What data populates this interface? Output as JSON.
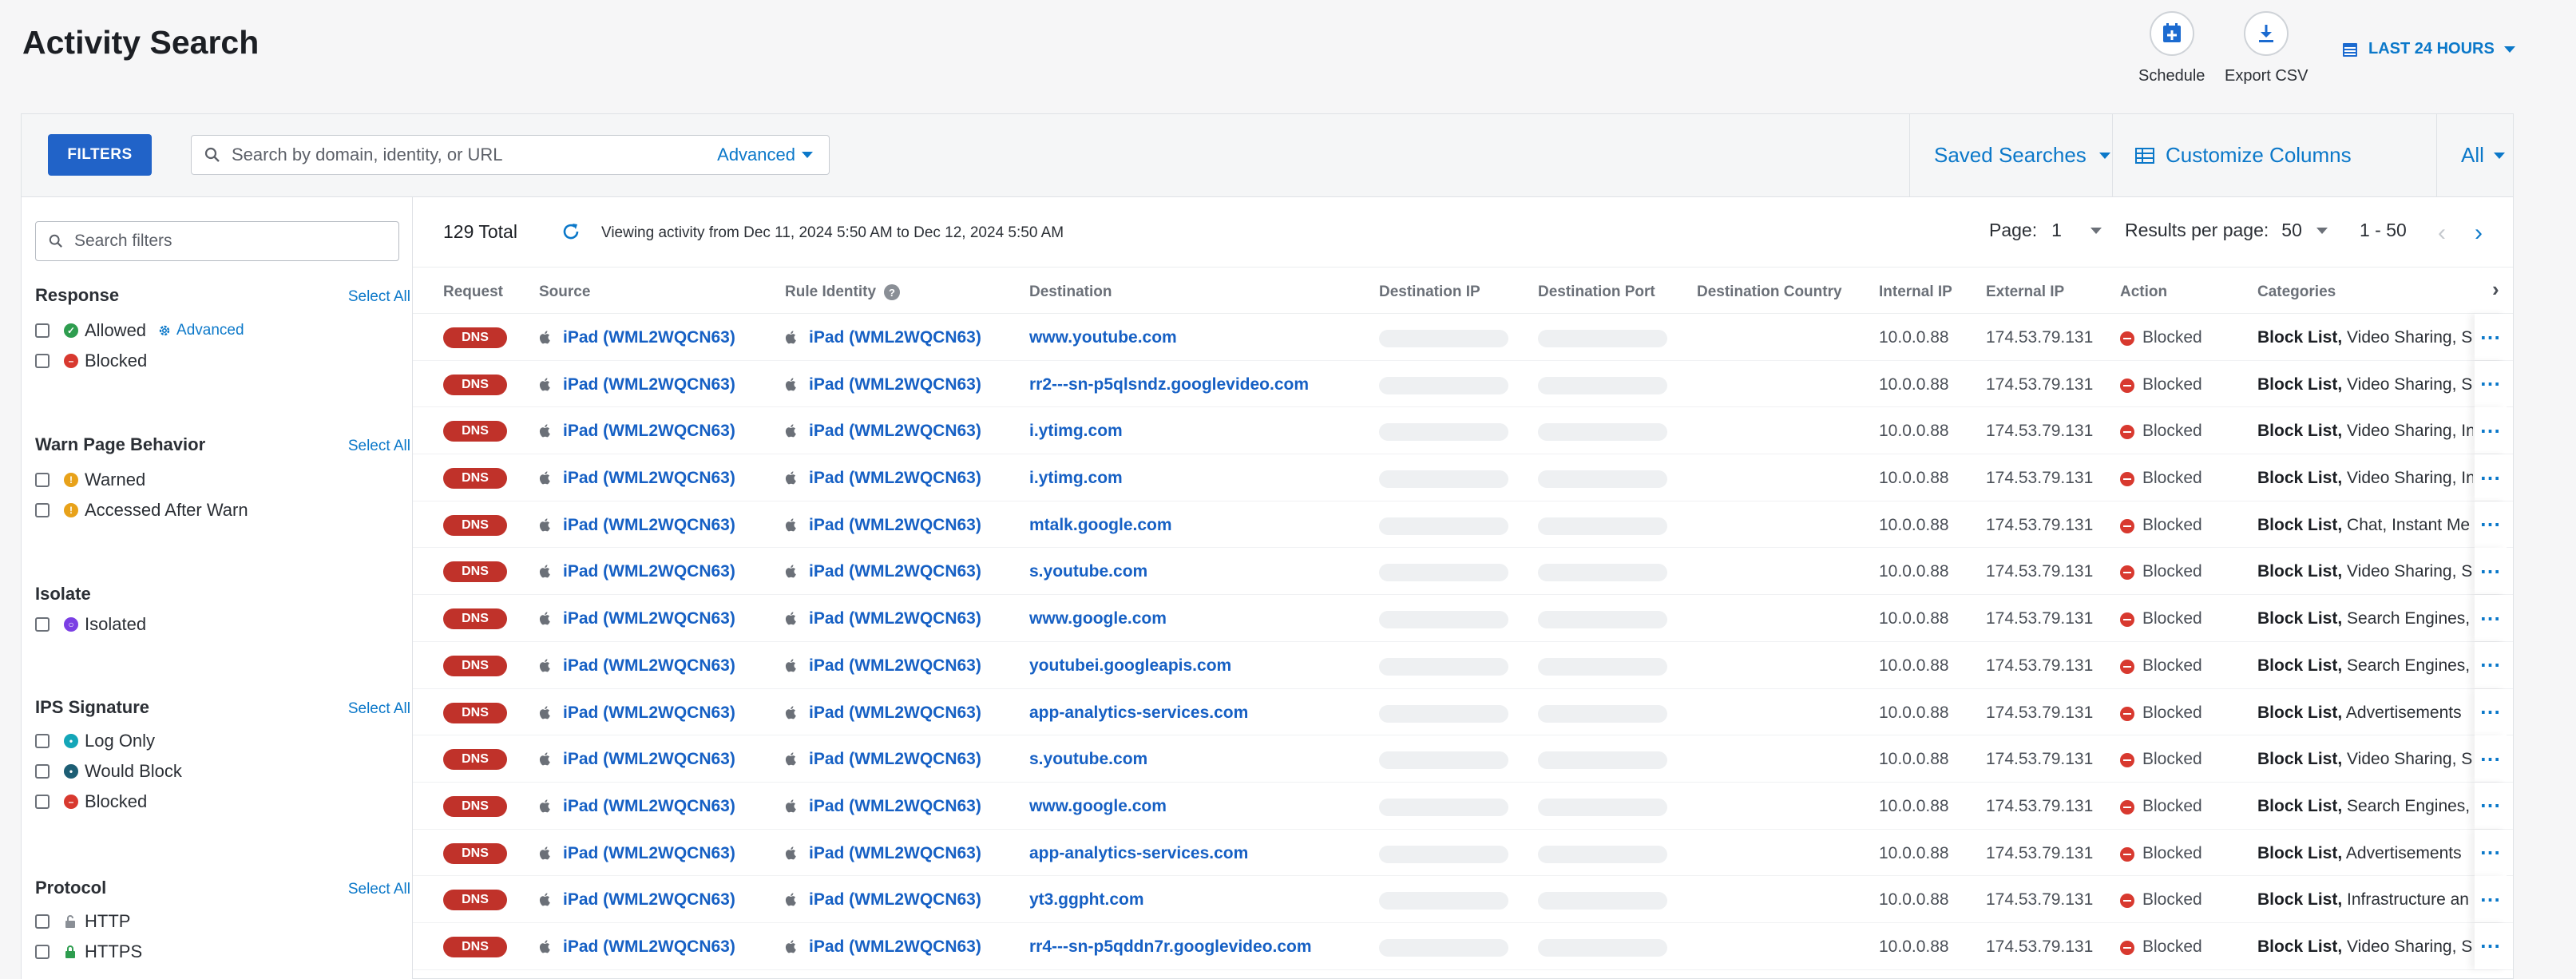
{
  "page_title": "Activity Search",
  "header_actions": {
    "schedule_label": "Schedule",
    "export_label": "Export CSV",
    "time_range": "LAST 24 HOURS"
  },
  "toolbar": {
    "filters_label": "FILTERS",
    "search_placeholder": "Search by domain, identity, or URL",
    "advanced_label": "Advanced",
    "saved_searches_label": "Saved Searches",
    "customize_columns_label": "Customize Columns",
    "scope_label": "All"
  },
  "sidebar": {
    "search_placeholder": "Search filters",
    "select_all": "Select All",
    "advanced_label": "Advanced",
    "sections": {
      "response": {
        "title": "Response",
        "options": [
          "Allowed",
          "Blocked"
        ]
      },
      "warn": {
        "title": "Warn Page Behavior",
        "options": [
          "Warned",
          "Accessed After Warn"
        ]
      },
      "isolate": {
        "title": "Isolate",
        "options": [
          "Isolated"
        ]
      },
      "ips": {
        "title": "IPS Signature",
        "options": [
          "Log Only",
          "Would Block",
          "Blocked"
        ]
      },
      "protocol": {
        "title": "Protocol",
        "options": [
          "HTTP",
          "HTTPS"
        ]
      }
    }
  },
  "summary": {
    "total": "129 Total",
    "viewing": "Viewing activity from Dec 11, 2024 5:50 AM to Dec 12, 2024 5:50 AM",
    "page_label": "Page:",
    "page_value": "1",
    "rpp_label": "Results per page:",
    "rpp_value": "50",
    "range": "1 - 50"
  },
  "columns": {
    "request": "Request",
    "source": "Source",
    "rule_identity": "Rule Identity",
    "destination": "Destination",
    "destination_ip": "Destination IP",
    "destination_port": "Destination Port",
    "destination_country": "Destination Country",
    "internal_ip": "Internal IP",
    "external_ip": "External IP",
    "action": "Action",
    "categories": "Categories"
  },
  "rows": [
    {
      "request": "DNS",
      "source": "iPad (WML2WQCN63)",
      "identity": "iPad (WML2WQCN63)",
      "destination": "www.youtube.com",
      "internal_ip": "10.0.0.88",
      "external_ip": "174.53.79.131",
      "action": "Blocked",
      "cat_bold": "Block List,",
      "cat_rest": " Video Sharing, S"
    },
    {
      "request": "DNS",
      "source": "iPad (WML2WQCN63)",
      "identity": "iPad (WML2WQCN63)",
      "destination": "rr2---sn-p5qlsndz.googlevideo.com",
      "internal_ip": "10.0.0.88",
      "external_ip": "174.53.79.131",
      "action": "Blocked",
      "cat_bold": "Block List,",
      "cat_rest": " Video Sharing, S"
    },
    {
      "request": "DNS",
      "source": "iPad (WML2WQCN63)",
      "identity": "iPad (WML2WQCN63)",
      "destination": "i.ytimg.com",
      "internal_ip": "10.0.0.88",
      "external_ip": "174.53.79.131",
      "action": "Blocked",
      "cat_bold": "Block List,",
      "cat_rest": " Video Sharing, In"
    },
    {
      "request": "DNS",
      "source": "iPad (WML2WQCN63)",
      "identity": "iPad (WML2WQCN63)",
      "destination": "i.ytimg.com",
      "internal_ip": "10.0.0.88",
      "external_ip": "174.53.79.131",
      "action": "Blocked",
      "cat_bold": "Block List,",
      "cat_rest": " Video Sharing, In"
    },
    {
      "request": "DNS",
      "source": "iPad (WML2WQCN63)",
      "identity": "iPad (WML2WQCN63)",
      "destination": "mtalk.google.com",
      "internal_ip": "10.0.0.88",
      "external_ip": "174.53.79.131",
      "action": "Blocked",
      "cat_bold": "Block List,",
      "cat_rest": " Chat, Instant Me"
    },
    {
      "request": "DNS",
      "source": "iPad (WML2WQCN63)",
      "identity": "iPad (WML2WQCN63)",
      "destination": "s.youtube.com",
      "internal_ip": "10.0.0.88",
      "external_ip": "174.53.79.131",
      "action": "Blocked",
      "cat_bold": "Block List,",
      "cat_rest": " Video Sharing, S"
    },
    {
      "request": "DNS",
      "source": "iPad (WML2WQCN63)",
      "identity": "iPad (WML2WQCN63)",
      "destination": "www.google.com",
      "internal_ip": "10.0.0.88",
      "external_ip": "174.53.79.131",
      "action": "Blocked",
      "cat_bold": "Block List,",
      "cat_rest": " Search Engines, "
    },
    {
      "request": "DNS",
      "source": "iPad (WML2WQCN63)",
      "identity": "iPad (WML2WQCN63)",
      "destination": "youtubei.googleapis.com",
      "internal_ip": "10.0.0.88",
      "external_ip": "174.53.79.131",
      "action": "Blocked",
      "cat_bold": "Block List,",
      "cat_rest": " Search Engines, "
    },
    {
      "request": "DNS",
      "source": "iPad (WML2WQCN63)",
      "identity": "iPad (WML2WQCN63)",
      "destination": "app-analytics-services.com",
      "internal_ip": "10.0.0.88",
      "external_ip": "174.53.79.131",
      "action": "Blocked",
      "cat_bold": "Block List,",
      "cat_rest": " Advertisements"
    },
    {
      "request": "DNS",
      "source": "iPad (WML2WQCN63)",
      "identity": "iPad (WML2WQCN63)",
      "destination": "s.youtube.com",
      "internal_ip": "10.0.0.88",
      "external_ip": "174.53.79.131",
      "action": "Blocked",
      "cat_bold": "Block List,",
      "cat_rest": " Video Sharing, S"
    },
    {
      "request": "DNS",
      "source": "iPad (WML2WQCN63)",
      "identity": "iPad (WML2WQCN63)",
      "destination": "www.google.com",
      "internal_ip": "10.0.0.88",
      "external_ip": "174.53.79.131",
      "action": "Blocked",
      "cat_bold": "Block List,",
      "cat_rest": " Search Engines, "
    },
    {
      "request": "DNS",
      "source": "iPad (WML2WQCN63)",
      "identity": "iPad (WML2WQCN63)",
      "destination": "app-analytics-services.com",
      "internal_ip": "10.0.0.88",
      "external_ip": "174.53.79.131",
      "action": "Blocked",
      "cat_bold": "Block List,",
      "cat_rest": " Advertisements"
    },
    {
      "request": "DNS",
      "source": "iPad (WML2WQCN63)",
      "identity": "iPad (WML2WQCN63)",
      "destination": "yt3.ggpht.com",
      "internal_ip": "10.0.0.88",
      "external_ip": "174.53.79.131",
      "action": "Blocked",
      "cat_bold": "Block List,",
      "cat_rest": " Infrastructure an"
    },
    {
      "request": "DNS",
      "source": "iPad (WML2WQCN63)",
      "identity": "iPad (WML2WQCN63)",
      "destination": "rr4---sn-p5qddn7r.googlevideo.com",
      "internal_ip": "10.0.0.88",
      "external_ip": "174.53.79.131",
      "action": "Blocked",
      "cat_bold": "Block List,",
      "cat_rest": " Video Sharing, S"
    }
  ],
  "colors": {
    "accent": "#0b78c9",
    "primary_button": "#2163c8",
    "link": "#1660c4",
    "blocked": "#d8392f",
    "dns_badge": "#c0322a",
    "allowed": "#2e9d4f",
    "warned": "#e8a21a",
    "isolated": "#7b3fe4",
    "log_only": "#14a6b8",
    "would_block": "#1d5e74"
  }
}
